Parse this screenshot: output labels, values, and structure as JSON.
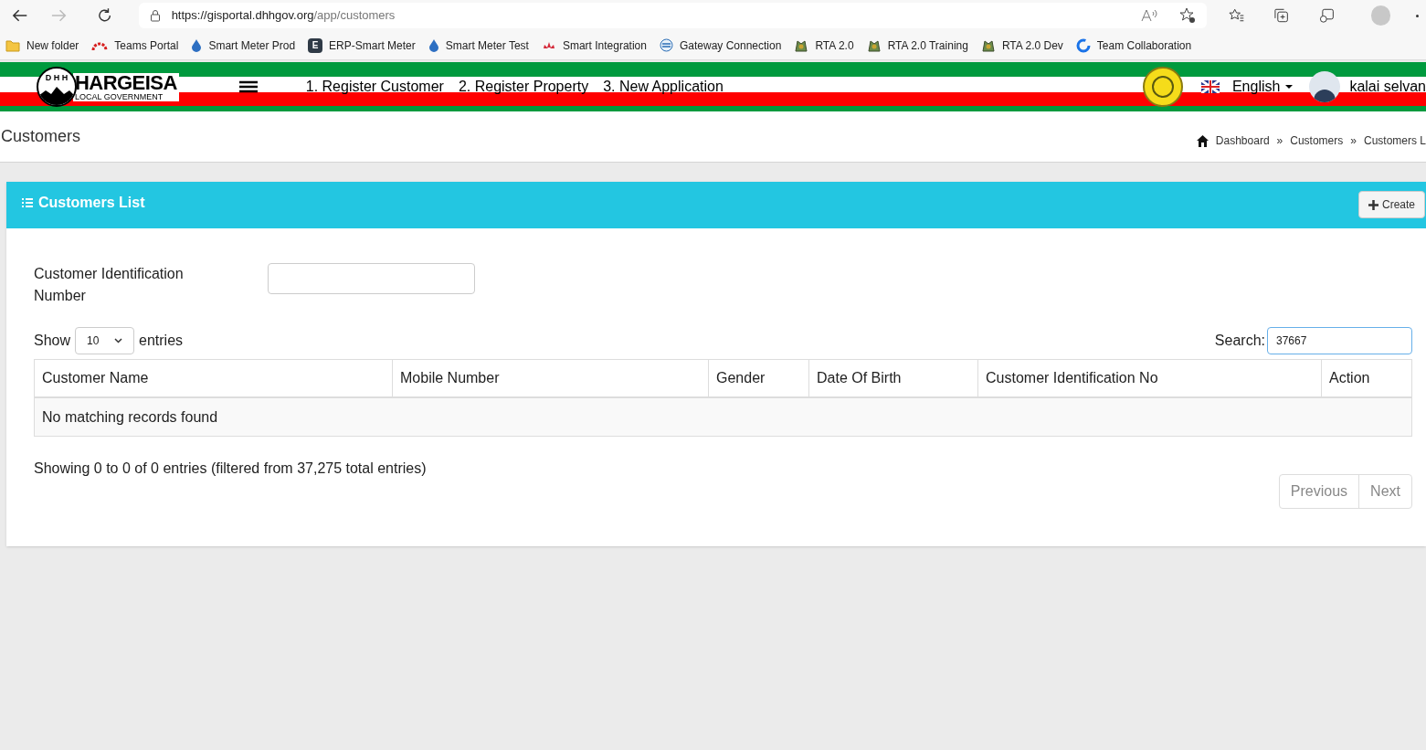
{
  "browser": {
    "url_host": "https://gisportal.dhhgov.org",
    "url_path": "/app/customers"
  },
  "bookmarks": [
    {
      "label": "New folder",
      "kind": "folder"
    },
    {
      "label": "Teams Portal",
      "kind": "arc"
    },
    {
      "label": "Smart Meter Prod",
      "kind": "drop"
    },
    {
      "label": "ERP-Smart Meter",
      "kind": "letter",
      "letter": "E"
    },
    {
      "label": "Smart Meter Test",
      "kind": "drop"
    },
    {
      "label": "Smart Integration",
      "kind": "flower"
    },
    {
      "label": "Gateway Connection",
      "kind": "globe"
    },
    {
      "label": "RTA 2.0",
      "kind": "emblem"
    },
    {
      "label": "RTA 2.0 Training",
      "kind": "emblem"
    },
    {
      "label": "RTA 2.0 Dev",
      "kind": "emblem"
    },
    {
      "label": "Team Collaboration",
      "kind": "ring"
    }
  ],
  "header": {
    "logo_title": "HARGEISA",
    "logo_subtitle": "LOCAL GOVERNMENT",
    "logo_letters": "D H H",
    "nav": [
      "1. Register Customer",
      "2. Register Property",
      "3. New Application"
    ],
    "language": "English",
    "user": "kalai selvan"
  },
  "page": {
    "title": "Customers",
    "breadcrumbs": [
      "Dashboard",
      "Customers",
      "Customers L"
    ],
    "separator": "»"
  },
  "card": {
    "title": "Customers List",
    "create": "Create",
    "filter": {
      "label": "Customer Identification Number"
    },
    "show": {
      "before": "Show",
      "value": "10",
      "after": "entries"
    },
    "search": {
      "label": "Search:",
      "value": "37667"
    },
    "columns": [
      "Customer Name",
      "Mobile Number",
      "Gender",
      "Date Of Birth",
      "Customer Identification No",
      "Action"
    ],
    "empty": "No matching records found",
    "info": "Showing 0 to 0 of 0 entries (filtered from 37,275 total entries)",
    "pagination": [
      {
        "label": "Previous",
        "disabled": true
      },
      {
        "label": "Next",
        "disabled": true
      }
    ]
  }
}
